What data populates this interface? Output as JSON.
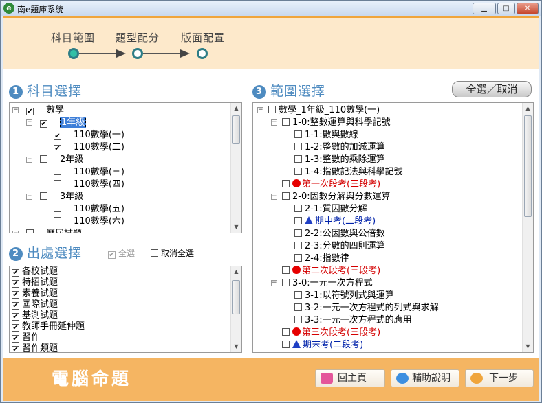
{
  "window": {
    "title": "南e題庫系統",
    "app_icon": "e"
  },
  "steps": [
    "科目範圍",
    "題型配分",
    "版面配置"
  ],
  "section1": {
    "num": "1",
    "title": "科目選擇"
  },
  "section2": {
    "num": "2",
    "title": "出處選擇",
    "select_all": "全選",
    "deselect_all": "取消全選"
  },
  "section3": {
    "num": "3",
    "title": "範圍選擇",
    "toggle_all": "全選／取消"
  },
  "subject_tree": [
    {
      "label": "數學",
      "checked": true,
      "level": 0
    },
    {
      "label": "1年級",
      "checked": true,
      "level": 1,
      "selected": true
    },
    {
      "label": "110數學(一)",
      "checked": true,
      "level": 2
    },
    {
      "label": "110數學(二)",
      "checked": true,
      "level": 2
    },
    {
      "label": "2年級",
      "checked": false,
      "level": 1
    },
    {
      "label": "110數學(三)",
      "checked": false,
      "level": 2
    },
    {
      "label": "110數學(四)",
      "checked": false,
      "level": 2
    },
    {
      "label": "3年級",
      "checked": false,
      "level": 1
    },
    {
      "label": "110數學(五)",
      "checked": false,
      "level": 2
    },
    {
      "label": "110數學(六)",
      "checked": false,
      "level": 2
    },
    {
      "label": "歷屆試題",
      "checked": false,
      "level": 0
    }
  ],
  "sources": [
    "各校試題",
    "特招試題",
    "素養試題",
    "國際試題",
    "基測試題",
    "教師手冊延伸題",
    "習作",
    "習作類題"
  ],
  "range_tree": [
    {
      "label": "數學_1年級_110數學(一)",
      "level": 0,
      "type": "text"
    },
    {
      "label": "1-0:整數運算與科學記號",
      "level": 1,
      "type": "text"
    },
    {
      "label": "1-1:數與數線",
      "level": 2,
      "type": "text"
    },
    {
      "label": "1-2:整數的加減運算",
      "level": 2,
      "type": "text"
    },
    {
      "label": "1-3:整數的乘除運算",
      "level": 2,
      "type": "text"
    },
    {
      "label": "1-4:指數記法與科學記號",
      "level": 2,
      "type": "text"
    },
    {
      "label": "第一次段考(三段考)",
      "level": 1,
      "type": "red"
    },
    {
      "label": "2-0:因數分解與分數運算",
      "level": 1,
      "type": "text"
    },
    {
      "label": "2-1:質因數分解",
      "level": 2,
      "type": "text"
    },
    {
      "label": "期中考(二段考)",
      "level": 2,
      "type": "blue"
    },
    {
      "label": "2-2:公因數與公倍數",
      "level": 2,
      "type": "text"
    },
    {
      "label": "2-3:分數的四則運算",
      "level": 2,
      "type": "text"
    },
    {
      "label": "2-4:指數律",
      "level": 2,
      "type": "text"
    },
    {
      "label": "第二次段考(三段考)",
      "level": 1,
      "type": "red"
    },
    {
      "label": "3-0:一元一次方程式",
      "level": 1,
      "type": "text"
    },
    {
      "label": "3-1:以符號列式與運算",
      "level": 2,
      "type": "text"
    },
    {
      "label": "3-2:一元一次方程式的列式與求解",
      "level": 2,
      "type": "text"
    },
    {
      "label": "3-3:一元一次方程式的應用",
      "level": 2,
      "type": "text"
    },
    {
      "label": "第三次段考(三段考)",
      "level": 1,
      "type": "red"
    },
    {
      "label": "期末考(二段考)",
      "level": 1,
      "type": "blue"
    }
  ],
  "footer": {
    "title": "電腦命題",
    "home": "回主頁",
    "help": "輔助說明",
    "next": "下一步"
  },
  "colors": {
    "header_bg": "#fde9cb",
    "footer_bg": "#f5b562",
    "accent": "#4e8bc0",
    "red": "#d40000",
    "blue": "#0022aa"
  }
}
